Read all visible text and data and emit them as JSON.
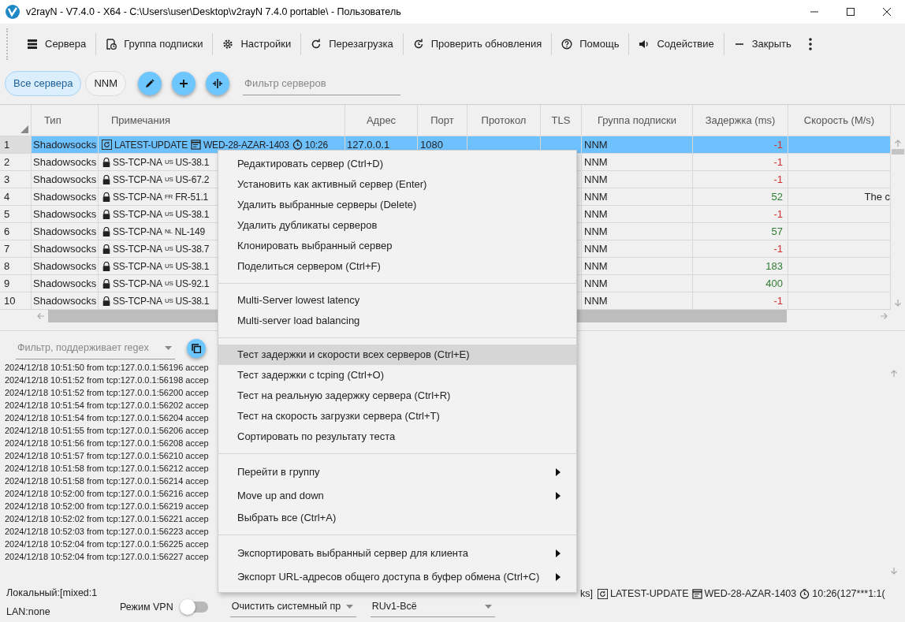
{
  "window": {
    "title": "v2rayN - V7.4.0 - X64 - C:\\Users\\user\\Desktop\\v2rayN 7.4.0 portable\\ - Пользователь"
  },
  "toolbar": {
    "items": [
      {
        "label": "Сервера"
      },
      {
        "label": "Группа подписки"
      },
      {
        "label": "Настройки"
      },
      {
        "label": "Перезагрузка"
      },
      {
        "label": "Проверить обновления"
      },
      {
        "label": "Помощь"
      },
      {
        "label": "Содействие"
      },
      {
        "label": "Закрыть"
      }
    ]
  },
  "groups": {
    "chips": [
      {
        "label": "Все сервера",
        "selected": true
      },
      {
        "label": "NNM",
        "selected": false
      }
    ],
    "filter": {
      "placeholder": "Фильтр серверов"
    }
  },
  "table": {
    "columns": [
      "Тип",
      "Примечания",
      "Адрес",
      "Порт",
      "Протокол",
      "TLS",
      "Группа подписки",
      "Задержка (ms)",
      "Скорость (M/s)"
    ],
    "rows": [
      {
        "number": "1",
        "type": "Shadowsocks",
        "notes": {
          "kind": "info",
          "parts": [
            "LATEST-UPDATE",
            "WED-28-AZAR-1403",
            "10:26"
          ]
        },
        "address": "127.0.0.1",
        "port": "1080",
        "group": "NNM",
        "delay": "-1",
        "color": "#d32f2f",
        "selected": true
      },
      {
        "number": "2",
        "type": "Shadowsocks",
        "notes": {
          "kind": "server",
          "prefix": "SS-TCP-NA",
          "country": "US",
          "name": "US-38.1"
        },
        "group": "NNM",
        "delay": "-1",
        "color": "#d32f2f",
        "selected": false
      },
      {
        "number": "3",
        "type": "Shadowsocks",
        "notes": {
          "kind": "server",
          "prefix": "SS-TCP-NA",
          "country": "US",
          "name": "US-67.2"
        },
        "group": "NNM",
        "delay": "-1",
        "color": "#d32f2f",
        "selected": false
      },
      {
        "number": "4",
        "type": "Shadowsocks",
        "notes": {
          "kind": "server",
          "prefix": "SS-TCP-NA",
          "country": "FR",
          "name": "FR-51.1"
        },
        "group": "NNM",
        "delay": "52",
        "color": "#2e7d32",
        "speed": "The c",
        "selected": false
      },
      {
        "number": "5",
        "type": "Shadowsocks",
        "notes": {
          "kind": "server",
          "prefix": "SS-TCP-NA",
          "country": "US",
          "name": "US-38.1"
        },
        "group": "NNM",
        "delay": "-1",
        "color": "#d32f2f",
        "selected": false
      },
      {
        "number": "6",
        "type": "Shadowsocks",
        "notes": {
          "kind": "server",
          "prefix": "SS-TCP-NA",
          "country": "NL",
          "name": "NL-149"
        },
        "group": "NNM",
        "delay": "57",
        "color": "#2e7d32",
        "selected": false
      },
      {
        "number": "7",
        "type": "Shadowsocks",
        "notes": {
          "kind": "server",
          "prefix": "SS-TCP-NA",
          "country": "US",
          "name": "US-38.7"
        },
        "group": "NNM",
        "delay": "-1",
        "color": "#d32f2f",
        "selected": false
      },
      {
        "number": "8",
        "type": "Shadowsocks",
        "notes": {
          "kind": "server",
          "prefix": "SS-TCP-NA",
          "country": "US",
          "name": "US-38.1"
        },
        "group": "NNM",
        "delay": "183",
        "color": "#2e7d32",
        "selected": false
      },
      {
        "number": "9",
        "type": "Shadowsocks",
        "notes": {
          "kind": "server",
          "prefix": "SS-TCP-NA",
          "country": "US",
          "name": "US-92.1"
        },
        "group": "NNM",
        "delay": "400",
        "color": "#2e7d32",
        "selected": false
      },
      {
        "number": "10",
        "type": "Shadowsocks",
        "notes": {
          "kind": "server",
          "prefix": "SS-TCP-NA",
          "country": "US",
          "name": "US-38.1"
        },
        "group": "NNM",
        "delay": "-1",
        "color": "#d32f2f",
        "selected": false
      }
    ]
  },
  "log": {
    "filter": {
      "placeholder": "Фильтр, поддерживает regex"
    },
    "lines": [
      "2024/12/18 10:51:50 from tcp:127.0.0.1:56196 accep",
      "2024/12/18 10:51:52 from tcp:127.0.0.1:56198 accep",
      "2024/12/18 10:51:52 from tcp:127.0.0.1:56200 accep",
      "2024/12/18 10:51:54 from tcp:127.0.0.1:56202 accep",
      "2024/12/18 10:51:54 from tcp:127.0.0.1:56204 accep",
      "2024/12/18 10:51:55 from tcp:127.0.0.1:56206 accep",
      "2024/12/18 10:51:56 from tcp:127.0.0.1:56208 accep",
      "2024/12/18 10:51:57 from tcp:127.0.0.1:56210 accep",
      "2024/12/18 10:51:58 from tcp:127.0.0.1:56212 accep",
      "2024/12/18 10:51:58 from tcp:127.0.0.1:56214 accep",
      "2024/12/18 10:52:00 from tcp:127.0.0.1:56216 accep",
      "2024/12/18 10:52:00 from tcp:127.0.0.1:56219 accep",
      "2024/12/18 10:52:02 from tcp:127.0.0.1:56221 accep",
      "2024/12/18 10:52:03 from tcp:127.0.0.1:56223 accep",
      "2024/12/18 10:52:04 from tcp:127.0.0.1:56225 accep",
      "2024/12/18 10:52:04 from tcp:127.0.0.1:56227 accep"
    ]
  },
  "status_bar": {
    "local": "Локальный:[mixed:1",
    "lan": "LAN:none",
    "vpn": {
      "label": "Режим VPN",
      "on": false
    },
    "proxy_mode": "Очистить системный пр",
    "routing": "RUv1-Всё",
    "info_parts": [
      "ks]",
      "LATEST-UPDATE",
      "WED-28-AZAR-1403",
      "10:26(127***1:1("
    ]
  },
  "context_menu": {
    "sections": [
      {
        "items": [
          {
            "label": "Редактировать сервер (Ctrl+D)",
            "selected": false,
            "submenu": false
          },
          {
            "label": "Установить как активный сервер (Enter)",
            "selected": false,
            "submenu": false
          },
          {
            "label": "Удалить выбранные серверы (Delete)",
            "selected": false,
            "submenu": false
          },
          {
            "label": "Удалить дубликаты серверов",
            "selected": false,
            "submenu": false
          },
          {
            "label": "Клонировать выбранный сервер",
            "selected": false,
            "submenu": false
          },
          {
            "label": "Поделиться сервером (Ctrl+F)",
            "selected": false,
            "submenu": false
          }
        ]
      },
      {
        "items": [
          {
            "label": "Multi-Server lowest latency",
            "selected": false,
            "submenu": false
          },
          {
            "label": "Multi-server load balancing",
            "selected": false,
            "submenu": false
          }
        ]
      },
      {
        "items": [
          {
            "label": "Тест задержки и скорости всех серверов (Ctrl+E)",
            "selected": true,
            "submenu": false
          },
          {
            "label": "Тест задержки с tcping (Ctrl+O)",
            "selected": false,
            "submenu": false
          },
          {
            "label": "Тест на реальную задержку сервера (Ctrl+R)",
            "selected": false,
            "submenu": false
          },
          {
            "label": "Тест на скорость загрузки сервера (Ctrl+T)",
            "selected": false,
            "submenu": false
          },
          {
            "label": "Сортировать по результату теста",
            "selected": false,
            "submenu": false
          }
        ]
      },
      {
        "items": [
          {
            "label": "Перейти в группу",
            "selected": false,
            "submenu": true
          },
          {
            "label": "Move up and down",
            "selected": false,
            "submenu": true
          },
          {
            "label": "Выбрать все (Ctrl+A)",
            "selected": false,
            "submenu": false
          }
        ]
      },
      {
        "items": [
          {
            "label": "Экспортировать выбранный сервер для клиента",
            "selected": false,
            "submenu": true
          },
          {
            "label": "Экспорт URL-адресов общего доступа в буфер обмена (Ctrl+C)",
            "selected": false,
            "submenu": true
          }
        ]
      }
    ]
  }
}
